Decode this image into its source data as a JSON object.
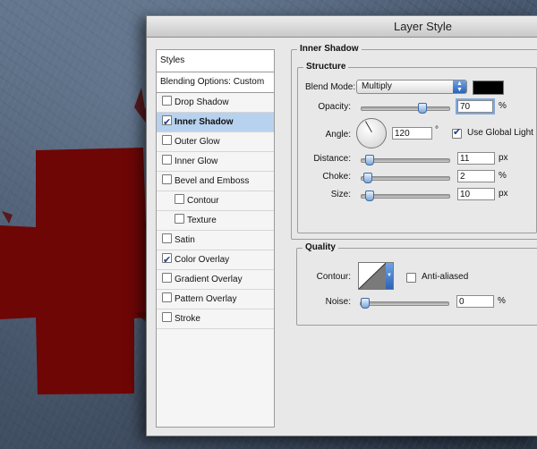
{
  "dialog": {
    "title": "Layer Style"
  },
  "styles_panel": {
    "header": "Styles",
    "blending_options": "Blending Options: Custom",
    "items": [
      {
        "label": "Drop Shadow",
        "checked": false,
        "selected": false,
        "sub": false
      },
      {
        "label": "Inner Shadow",
        "checked": true,
        "selected": true,
        "sub": false
      },
      {
        "label": "Outer Glow",
        "checked": false,
        "selected": false,
        "sub": false
      },
      {
        "label": "Inner Glow",
        "checked": false,
        "selected": false,
        "sub": false
      },
      {
        "label": "Bevel and Emboss",
        "checked": false,
        "selected": false,
        "sub": false
      },
      {
        "label": "Contour",
        "checked": false,
        "selected": false,
        "sub": true
      },
      {
        "label": "Texture",
        "checked": false,
        "selected": false,
        "sub": true
      },
      {
        "label": "Satin",
        "checked": false,
        "selected": false,
        "sub": false
      },
      {
        "label": "Color Overlay",
        "checked": true,
        "selected": false,
        "sub": false
      },
      {
        "label": "Gradient Overlay",
        "checked": false,
        "selected": false,
        "sub": false
      },
      {
        "label": "Pattern Overlay",
        "checked": false,
        "selected": false,
        "sub": false
      },
      {
        "label": "Stroke",
        "checked": false,
        "selected": false,
        "sub": false
      }
    ]
  },
  "inner_shadow": {
    "section_title": "Inner Shadow",
    "structure": {
      "title": "Structure",
      "blend_mode": {
        "label": "Blend Mode:",
        "value": "Multiply",
        "swatch_color": "#000000"
      },
      "opacity": {
        "label": "Opacity:",
        "value": "70",
        "unit": "%",
        "level": 70
      },
      "angle": {
        "label": "Angle:",
        "value": "120",
        "unit": "°",
        "degrees": 120,
        "use_global_light_label": "Use Global Light",
        "use_global_light": true
      },
      "distance": {
        "label": "Distance:",
        "value": "11",
        "unit": "px",
        "level": 4
      },
      "choke": {
        "label": "Choke:",
        "value": "2",
        "unit": "%",
        "level": 2
      },
      "size": {
        "label": "Size:",
        "value": "10",
        "unit": "px",
        "level": 4
      }
    },
    "quality": {
      "title": "Quality",
      "contour_label": "Contour:",
      "anti_aliased_label": "Anti-aliased",
      "anti_aliased": false,
      "noise": {
        "label": "Noise:",
        "value": "0",
        "unit": "%",
        "level": 0
      }
    }
  },
  "canvas": {
    "cross_color": "#6e0606"
  }
}
